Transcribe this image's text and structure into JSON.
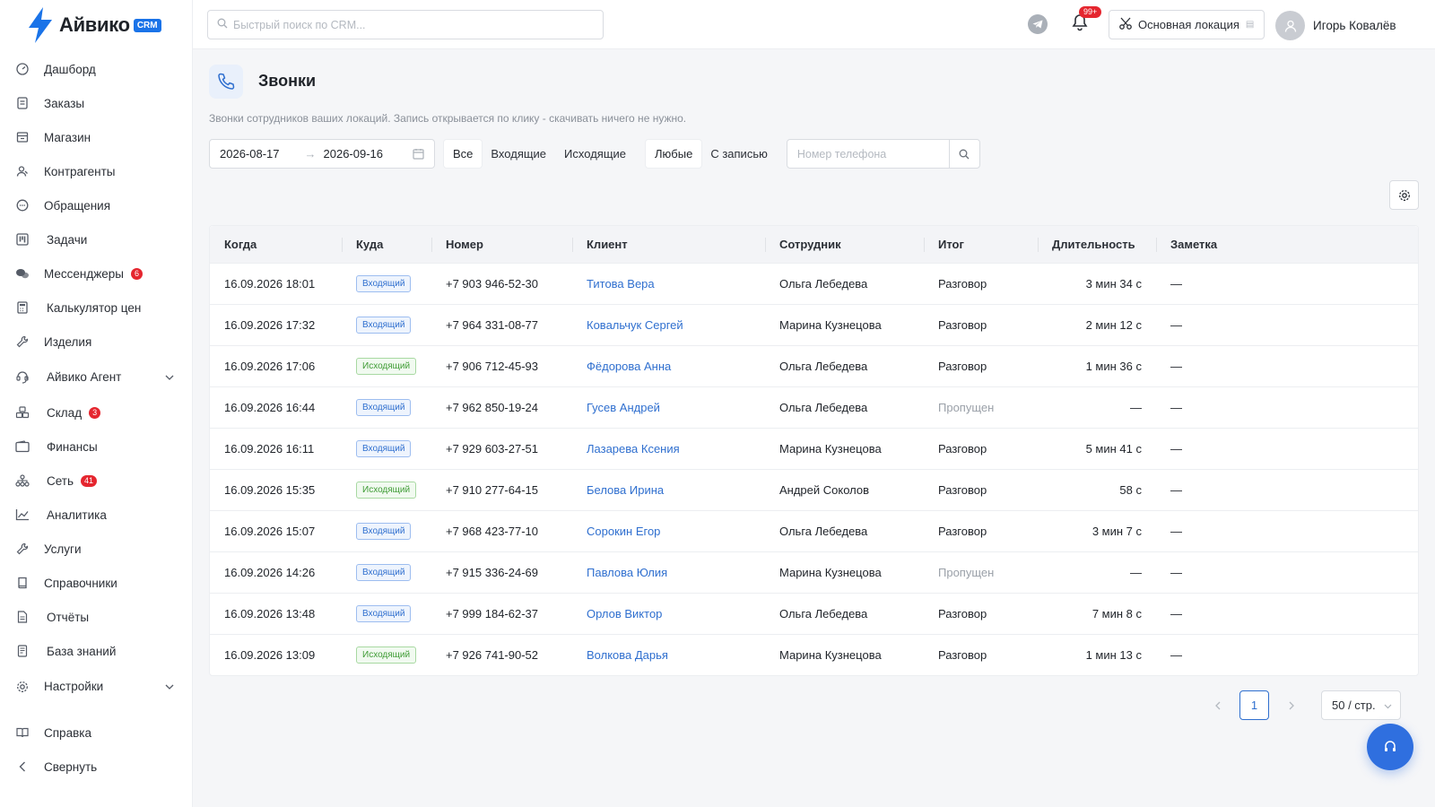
{
  "brand": {
    "name": "Айвико",
    "badge": "CRM",
    "color": "#1a73e8"
  },
  "sidebar": {
    "items": [
      {
        "label": "Дашборд",
        "icon": "dashboard-icon"
      },
      {
        "label": "Заказы",
        "icon": "document-icon"
      },
      {
        "label": "Магазин",
        "icon": "shop-icon"
      },
      {
        "label": "Контрагенты",
        "icon": "users-icon"
      },
      {
        "label": "Обращения",
        "icon": "chat-icon"
      },
      {
        "label": "Задачи",
        "icon": "kanban-icon"
      },
      {
        "label": "Мессенджеры",
        "icon": "messengers-icon",
        "badge": "6"
      },
      {
        "label": "Калькулятор цен",
        "icon": "calculator-icon"
      },
      {
        "label": "Изделия",
        "icon": "wrench-icon"
      },
      {
        "label": "Айвико Агент",
        "icon": "agent-icon",
        "expandable": true
      },
      {
        "label": "Склад",
        "icon": "warehouse-icon",
        "badge": "3"
      },
      {
        "label": "Финансы",
        "icon": "wallet-icon"
      },
      {
        "label": "Сеть",
        "icon": "network-icon",
        "badge": "41"
      },
      {
        "label": "Аналитика",
        "icon": "chart-icon"
      },
      {
        "label": "Услуги",
        "icon": "tools-icon"
      },
      {
        "label": "Справочники",
        "icon": "book-icon"
      },
      {
        "label": "Отчёты",
        "icon": "report-icon"
      },
      {
        "label": "База знаний",
        "icon": "knowledge-icon"
      },
      {
        "label": "Настройки",
        "icon": "gear-icon",
        "expandable": true
      }
    ],
    "bottom": [
      {
        "label": "Справка",
        "icon": "help-book-icon"
      },
      {
        "label": "Свернуть",
        "icon": "collapse-icon"
      }
    ]
  },
  "header": {
    "search_placeholder": "Быстрый поиск по CRM...",
    "notifications_badge": "99+",
    "location": "Основная локация",
    "user": "Игорь Ковалёв"
  },
  "page": {
    "title": "Звонки",
    "subtitle": "Звонки сотрудников ваших локаций. Запись открывается по клику - скачивать ничего не нужно."
  },
  "filters": {
    "date_from": "2026-08-17",
    "date_to": "2026-09-16",
    "direction": [
      "Все",
      "Входящие",
      "Исходящие"
    ],
    "recording": [
      "Любые",
      "С записью"
    ],
    "phone_placeholder": "Номер телефона"
  },
  "table": {
    "columns": [
      "Когда",
      "Куда",
      "Номер",
      "Клиент",
      "Сотрудник",
      "Итог",
      "Длительность",
      "Заметка"
    ],
    "rows": [
      {
        "when": "16.09.2026 18:01",
        "dir": "Входящий",
        "type": "in",
        "number": "+7 903 946-52-30",
        "client": "Титова Вера",
        "employee": "Ольга Лебедева",
        "result": "Разговор",
        "missed": false,
        "duration": "3 мин 34 с",
        "note": "—"
      },
      {
        "when": "16.09.2026 17:32",
        "dir": "Входящий",
        "type": "in",
        "number": "+7 964 331-08-77",
        "client": "Ковальчук Сергей",
        "employee": "Марина Кузнецова",
        "result": "Разговор",
        "missed": false,
        "duration": "2 мин 12 с",
        "note": "—"
      },
      {
        "when": "16.09.2026 17:06",
        "dir": "Исходящий",
        "type": "out",
        "number": "+7 906 712-45-93",
        "client": "Фёдорова Анна",
        "employee": "Ольга Лебедева",
        "result": "Разговор",
        "missed": false,
        "duration": "1 мин 36 с",
        "note": "—"
      },
      {
        "when": "16.09.2026 16:44",
        "dir": "Входящий",
        "type": "in",
        "number": "+7 962 850-19-24",
        "client": "Гусев Андрей",
        "employee": "Ольга Лебедева",
        "result": "Пропущен",
        "missed": true,
        "duration": "—",
        "note": "—"
      },
      {
        "when": "16.09.2026 16:11",
        "dir": "Входящий",
        "type": "in",
        "number": "+7 929 603-27-51",
        "client": "Лазарева Ксения",
        "employee": "Марина Кузнецова",
        "result": "Разговор",
        "missed": false,
        "duration": "5 мин 41 с",
        "note": "—"
      },
      {
        "when": "16.09.2026 15:35",
        "dir": "Исходящий",
        "type": "out",
        "number": "+7 910 277-64-15",
        "client": "Белова Ирина",
        "employee": "Андрей Соколов",
        "result": "Разговор",
        "missed": false,
        "duration": "58 с",
        "note": "—"
      },
      {
        "when": "16.09.2026 15:07",
        "dir": "Входящий",
        "type": "in",
        "number": "+7 968 423-77-10",
        "client": "Сорокин Егор",
        "employee": "Ольга Лебедева",
        "result": "Разговор",
        "missed": false,
        "duration": "3 мин 7 с",
        "note": "—"
      },
      {
        "when": "16.09.2026 14:26",
        "dir": "Входящий",
        "type": "in",
        "number": "+7 915 336-24-69",
        "client": "Павлова Юлия",
        "employee": "Марина Кузнецова",
        "result": "Пропущен",
        "missed": true,
        "duration": "—",
        "note": "—"
      },
      {
        "when": "16.09.2026 13:48",
        "dir": "Входящий",
        "type": "in",
        "number": "+7 999 184-62-37",
        "client": "Орлов Виктор",
        "employee": "Ольга Лебедева",
        "result": "Разговор",
        "missed": false,
        "duration": "7 мин 8 с",
        "note": "—"
      },
      {
        "when": "16.09.2026 13:09",
        "dir": "Исходящий",
        "type": "out",
        "number": "+7 926 741-90-52",
        "client": "Волкова Дарья",
        "employee": "Марина Кузнецова",
        "result": "Разговор",
        "missed": false,
        "duration": "1 мин 13 с",
        "note": "—"
      }
    ]
  },
  "pagination": {
    "page": "1",
    "page_size": "50 / стр."
  },
  "colors": {
    "accent": "#2f6fcf",
    "incoming": "#2f6fcf",
    "outgoing": "#3f9c35",
    "badge": "#e5262f"
  }
}
